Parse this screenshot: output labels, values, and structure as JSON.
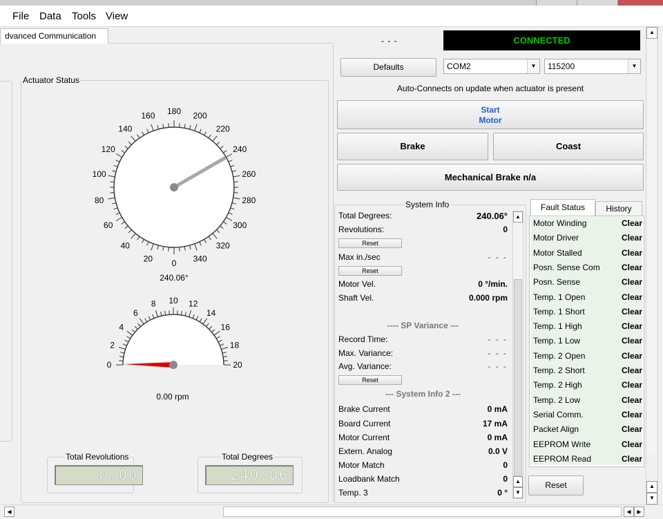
{
  "menu": {
    "file": "File",
    "data": "Data",
    "tools": "Tools",
    "view": "View"
  },
  "tab": {
    "label": "dvanced Communication"
  },
  "status_dashes": "- - -",
  "connection": {
    "status": "CONNECTED",
    "status_color": "#00c800"
  },
  "defaults_button": "Defaults",
  "port": {
    "value": "COM2"
  },
  "baud": {
    "value": "115200"
  },
  "auto_connect_text": "Auto-Connects on update when actuator is present",
  "start_motor": {
    "line1": "Start",
    "line2": "Motor",
    "color": "#1a5fd6"
  },
  "brake_button": "Brake",
  "coast_button": "Coast",
  "mech_brake_button": "Mechanical Brake n/a",
  "actuator_status": {
    "title": "Actuator Status",
    "position_gauge": {
      "labels": [
        "0",
        "20",
        "40",
        "60",
        "80",
        "100",
        "120",
        "140",
        "160",
        "180",
        "200",
        "220",
        "240",
        "260",
        "280",
        "300",
        "320",
        "340"
      ],
      "value": 240.06,
      "readout": "240.06°"
    },
    "speed_gauge": {
      "labels": [
        "0",
        "2",
        "4",
        "6",
        "8",
        "10",
        "12",
        "14",
        "16",
        "18",
        "20"
      ],
      "value": 0.0,
      "readout": "0.00 rpm",
      "needle_color": "#e00000"
    },
    "total_revolutions": {
      "title": "Total Revolutions",
      "value": "0.00"
    },
    "total_degrees": {
      "title": "Total Degrees",
      "value": "240.06"
    }
  },
  "system_info": {
    "title": "System Info",
    "total_degrees": {
      "label": "Total Degrees:",
      "value": "240.06°"
    },
    "revolutions": {
      "label": "Revolutions:",
      "value": "0"
    },
    "reset1": "Reset",
    "max_in_sec": {
      "label": "Max in./sec",
      "value": "- - -"
    },
    "reset2": "Reset",
    "motor_vel": {
      "label": "Motor Vel.",
      "value": "0 °/min."
    },
    "shaft_vel": {
      "label": "Shaft Vel.",
      "value": "0.000 rpm"
    },
    "sp_variance_header": "---- SP Variance ---",
    "record_time": {
      "label": "Record Time:",
      "value": "- - -"
    },
    "max_variance": {
      "label": "Max. Variance:",
      "value": "- - -"
    },
    "avg_variance": {
      "label": "Avg. Variance:",
      "value": "- - -"
    },
    "reset3": "Reset",
    "system_info2_header": "--- System Info 2 ---",
    "brake_current": {
      "label": "Brake Current",
      "value": "0 mA"
    },
    "board_current": {
      "label": "Board Current",
      "value": "17 mA"
    },
    "motor_current": {
      "label": "Motor Current",
      "value": "0 mA"
    },
    "extern_analog": {
      "label": "Extern. Analog",
      "value": "0.0 V"
    },
    "motor_match": {
      "label": "Motor Match",
      "value": "0"
    },
    "loadbank_match": {
      "label": "Loadbank Match",
      "value": "0"
    },
    "temp3": {
      "label": "Temp. 3",
      "value": "0 °"
    }
  },
  "fault_tabs": {
    "fault_status": "Fault Status",
    "history": "History"
  },
  "faults": [
    {
      "label": "Motor Winding",
      "value": "Clear"
    },
    {
      "label": "Motor Driver",
      "value": "Clear"
    },
    {
      "label": "Motor Stalled",
      "value": "Clear"
    },
    {
      "label": "Posn. Sense Com",
      "value": "Clear"
    },
    {
      "label": "Posn. Sense",
      "value": "Clear"
    },
    {
      "label": "Temp. 1 Open",
      "value": "Clear"
    },
    {
      "label": "Temp. 1 Short",
      "value": "Clear"
    },
    {
      "label": "Temp. 1 High",
      "value": "Clear"
    },
    {
      "label": "Temp. 1 Low",
      "value": "Clear"
    },
    {
      "label": "Temp. 2 Open",
      "value": "Clear"
    },
    {
      "label": "Temp. 2 Short",
      "value": "Clear"
    },
    {
      "label": "Temp. 2 High",
      "value": "Clear"
    },
    {
      "label": "Temp. 2 Low",
      "value": "Clear"
    },
    {
      "label": "Serial Comm.",
      "value": "Clear"
    },
    {
      "label": "Packet Align",
      "value": "Clear"
    },
    {
      "label": "EEPROM Write",
      "value": "Clear"
    },
    {
      "label": "EEPROM Read",
      "value": "Clear"
    }
  ],
  "fault_reset": "Reset"
}
